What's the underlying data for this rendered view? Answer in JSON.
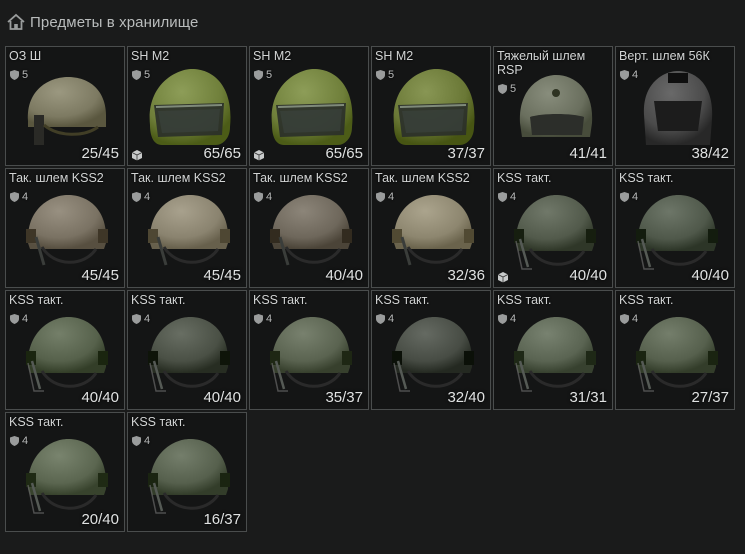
{
  "header": {
    "title": "Предметы в хранилище",
    "icon": "home-icon"
  },
  "colors": {
    "background": "#1a1b1b",
    "cell_bg": "#141515",
    "cell_border": "#4a4d4d",
    "text": "#d2d4d4"
  },
  "items": [
    {
      "name": "ОЗ Ш",
      "armor": "5",
      "durability": "25/45",
      "model": "oz",
      "color": "#7d7a62",
      "found": false
    },
    {
      "name": "SH M2",
      "armor": "5",
      "durability": "65/65",
      "model": "sh",
      "color": "#6f7f3a",
      "found": true
    },
    {
      "name": "SH M2",
      "armor": "5",
      "durability": "65/65",
      "model": "sh",
      "color": "#6f7f3a",
      "found": true
    },
    {
      "name": "SH M2",
      "armor": "5",
      "durability": "37/37",
      "model": "sh",
      "color": "#6a7836",
      "found": false
    },
    {
      "name": "Тяжелый шлем RSP",
      "armor": "5",
      "durability": "41/41",
      "model": "rsp",
      "color": "#6a6f5e",
      "found": false
    },
    {
      "name": "Верт. шлем 56К",
      "armor": "4",
      "durability": "38/42",
      "model": "vert",
      "color": "#4b4b4b",
      "found": false
    },
    {
      "name": "Так. шлем KSS2",
      "armor": "4",
      "durability": "45/45",
      "model": "kss2",
      "color": "#7a7263",
      "found": false
    },
    {
      "name": "Так. шлем KSS2",
      "armor": "4",
      "durability": "45/45",
      "model": "kss2",
      "color": "#8a836f",
      "found": false
    },
    {
      "name": "Так. шлем KSS2",
      "armor": "4",
      "durability": "40/40",
      "model": "kss2",
      "color": "#6e675b",
      "found": false
    },
    {
      "name": "Так. шлем KSS2",
      "armor": "4",
      "durability": "32/36",
      "model": "kss2",
      "color": "#8d866f",
      "found": false
    },
    {
      "name": "KSS такт.",
      "armor": "4",
      "durability": "40/40",
      "model": "kss",
      "color": "#525a4b",
      "found": true
    },
    {
      "name": "KSS такт.",
      "armor": "4",
      "durability": "40/40",
      "model": "kss",
      "color": "#4f584a",
      "found": false
    },
    {
      "name": "KSS такт.",
      "armor": "4",
      "durability": "40/40",
      "model": "kss",
      "color": "#56614b",
      "found": false
    },
    {
      "name": "KSS такт.",
      "armor": "4",
      "durability": "40/40",
      "model": "kss",
      "color": "#4a5045",
      "found": false
    },
    {
      "name": "KSS такт.",
      "armor": "4",
      "durability": "35/37",
      "model": "kss",
      "color": "#5a6350",
      "found": false
    },
    {
      "name": "KSS такт.",
      "armor": "4",
      "durability": "32/40",
      "model": "kss",
      "color": "#474c44",
      "found": false
    },
    {
      "name": "KSS такт.",
      "armor": "4",
      "durability": "31/31",
      "model": "kss",
      "color": "#5a6452",
      "found": false
    },
    {
      "name": "KSS такт.",
      "armor": "4",
      "durability": "27/37",
      "model": "kss",
      "color": "#56604d",
      "found": false
    },
    {
      "name": "KSS такт.",
      "armor": "4",
      "durability": "20/40",
      "model": "kss",
      "color": "#5b6650",
      "found": false
    },
    {
      "name": "KSS такт.",
      "armor": "4",
      "durability": "16/37",
      "model": "kss",
      "color": "#56604d",
      "found": false
    }
  ]
}
